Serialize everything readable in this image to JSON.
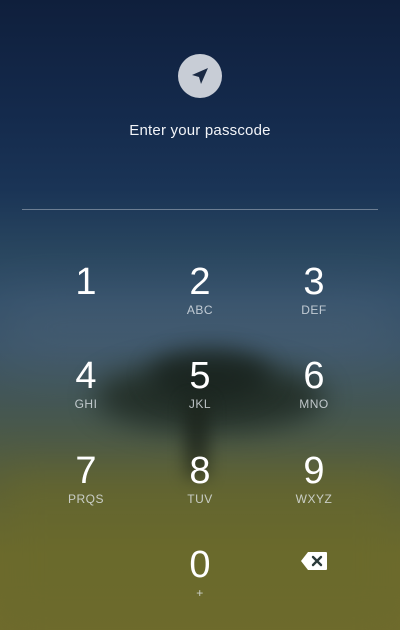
{
  "header": {
    "app_icon": "send-arrow-icon",
    "prompt": "Enter your passcode"
  },
  "keypad": {
    "keys": [
      {
        "digit": "1",
        "letters": ""
      },
      {
        "digit": "2",
        "letters": "ABC"
      },
      {
        "digit": "3",
        "letters": "DEF"
      },
      {
        "digit": "4",
        "letters": "GHI"
      },
      {
        "digit": "5",
        "letters": "JKL"
      },
      {
        "digit": "6",
        "letters": "MNO"
      },
      {
        "digit": "7",
        "letters": "PRQS"
      },
      {
        "digit": "8",
        "letters": "TUV"
      },
      {
        "digit": "9",
        "letters": "WXYZ"
      },
      {
        "digit": "0",
        "letters": "+"
      }
    ],
    "delete_icon": "backspace-icon"
  },
  "colors": {
    "background_top": "#0f1f3c",
    "background_bottom": "#6f6b2d",
    "icon_circle": "#c8cdd6",
    "text": "#ffffff"
  }
}
